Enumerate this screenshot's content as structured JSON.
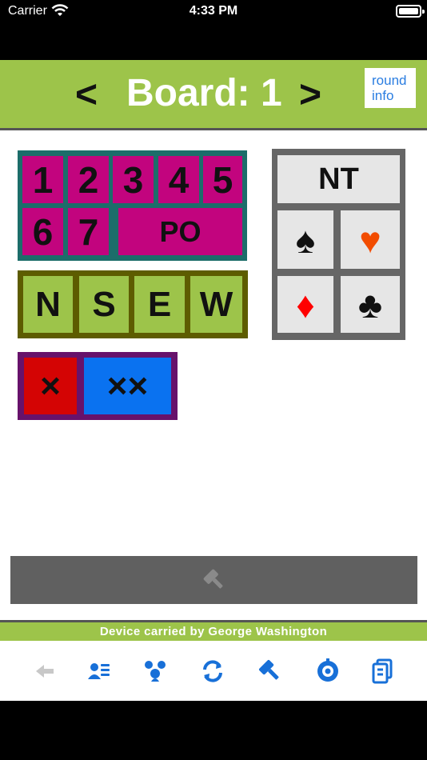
{
  "status": {
    "carrier": "Carrier",
    "time": "4:33 PM"
  },
  "header": {
    "prev": "<",
    "next": ">",
    "title": "Board: 1",
    "round_info_line1": "round",
    "round_info_line2": "info"
  },
  "levels": [
    "1",
    "2",
    "3",
    "4",
    "5",
    "6",
    "7"
  ],
  "pass_label": "PO",
  "seats": [
    "N",
    "S",
    "E",
    "W"
  ],
  "doubles": {
    "double": "×",
    "redouble": "××"
  },
  "strains": {
    "notrump": "NT",
    "spade": "♠",
    "heart": "♥",
    "diamond": "♦",
    "club": "♣"
  },
  "footer": {
    "device_text": "Device carried by George Washington"
  },
  "toolbar": [
    "back-arrow-icon",
    "player-list-icon",
    "group-icon",
    "refresh-icon",
    "gavel-icon",
    "settings-icon",
    "scorecard-icon"
  ],
  "colors": {
    "header_green": "#9dc44a",
    "level_bg": "#1c6d6a",
    "level_tile": "#c2047e",
    "seat_bg": "#5d5c00",
    "double_bg": "#67126b",
    "double_red": "#d40404",
    "redouble_blue": "#0a72f0",
    "heart": "#f24c00",
    "diamond": "#ff0000",
    "toolbar_blue": "#1870d8"
  }
}
